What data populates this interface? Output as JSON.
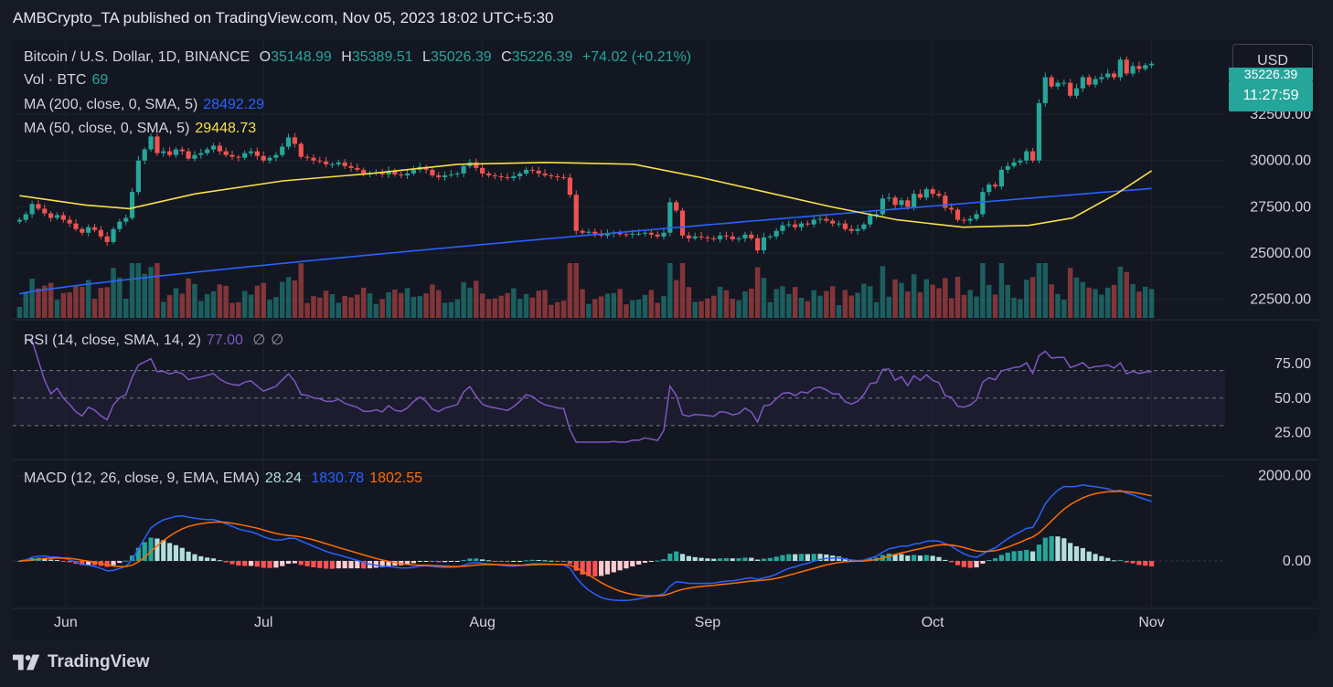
{
  "header": {
    "publisher_line": "AMBCrypto_TA published on TradingView.com, Nov 05, 2023 18:02 UTC+5:30"
  },
  "footer": {
    "brand": "TradingView"
  },
  "colors": {
    "up": "#26a69a",
    "down": "#ef5350",
    "ma200": "#2962ff",
    "ma50": "#f7e04a",
    "rsi": "#7e57c2",
    "macd": "#2962ff",
    "signal": "#ff6d00",
    "grid": "#1e222d",
    "axis_text": "#d1d4dc"
  },
  "toolbar": {
    "currency_button": "USD"
  },
  "price_tag": {
    "value_partial": "35226.39",
    "countdown": "11:27:59"
  },
  "legend": {
    "symbol": "Bitcoin / U.S. Dollar, 1D, BINANCE",
    "o_label": "O",
    "o_value": "35148.99",
    "h_label": "H",
    "h_value": "35389.51",
    "l_label": "L",
    "l_value": "35026.39",
    "c_label": "C",
    "c_value": "35226.39",
    "change": "+74.02 (+0.21%)",
    "vol_label": "Vol · BTC",
    "vol_value": "69",
    "ma200_label": "MA (200, close, 0, SMA, 5)",
    "ma200_value": "28492.29",
    "ma50_label": "MA (50, close, 0, SMA, 5)",
    "ma50_value": "29448.73",
    "rsi_label": "RSI (14, close, SMA, 14, 2)",
    "rsi_value": "77.00",
    "rsi_extra1": "∅",
    "rsi_extra2": "∅",
    "macd_label": "MACD (12, 26, close, 9, EMA, EMA)",
    "macd_hist": "28.24",
    "macd_value": "1830.78",
    "macd_signal": "1802.55"
  },
  "chart_data": [
    {
      "type": "candlestick",
      "title": "Bitcoin / U.S. Dollar, 1D, BINANCE",
      "x_ticks": [
        "Jun",
        "Jul",
        "Aug",
        "Sep",
        "Oct",
        "Nov"
      ],
      "y_ticks": [
        "22500.00",
        "25000.00",
        "27500.00",
        "30000.00",
        "32500.00"
      ],
      "ylim": [
        21500,
        36500
      ],
      "close_series": [
        26800,
        27100,
        27650,
        27400,
        27150,
        26900,
        27050,
        26800,
        26600,
        26300,
        26100,
        26400,
        26250,
        25900,
        25600,
        26300,
        26700,
        26900,
        28300,
        30000,
        30600,
        31300,
        30400,
        30500,
        30300,
        30600,
        30500,
        30100,
        30300,
        30400,
        30600,
        30800,
        30500,
        30300,
        30200,
        30150,
        30400,
        30500,
        30250,
        30000,
        30150,
        30300,
        30750,
        31250,
        30900,
        30200,
        30150,
        30000,
        29950,
        29800,
        29800,
        29900,
        29700,
        29600,
        29500,
        29300,
        29300,
        29350,
        29250,
        29450,
        29250,
        29200,
        29300,
        29500,
        29650,
        29500,
        29200,
        29100,
        29200,
        29250,
        29300,
        29700,
        29900,
        29600,
        29300,
        29200,
        29150,
        29100,
        29050,
        29150,
        29300,
        29500,
        29450,
        29300,
        29200,
        29150,
        29100,
        29080,
        28150,
        26200,
        26100,
        26150,
        26050,
        25950,
        26050,
        26100,
        26020,
        26000,
        26050,
        26050,
        26100,
        26000,
        25900,
        26100,
        27750,
        27300,
        25950,
        25800,
        25900,
        25850,
        25800,
        25750,
        25950,
        25900,
        25750,
        25800,
        26000,
        25800,
        25150,
        25850,
        25900,
        26200,
        26500,
        26550,
        26400,
        26600,
        26550,
        26800,
        26850,
        26750,
        26600,
        26600,
        26300,
        26200,
        26300,
        26550,
        27050,
        27100,
        27950,
        28000,
        27600,
        27850,
        27500,
        28200,
        28000,
        28450,
        28200,
        28100,
        27450,
        27350,
        26800,
        26750,
        26850,
        27100,
        28300,
        28700,
        28600,
        29500,
        29700,
        29900,
        30000,
        30500,
        30000,
        33100,
        34500,
        34000,
        34200,
        34200,
        33500,
        33900,
        34500,
        34100,
        34400,
        34500,
        34700,
        34500,
        35450,
        34700,
        35100,
        34950,
        35150,
        35230
      ],
      "ma200_start": 22800,
      "ma200_end": 28492.29,
      "ma50_points": [
        [
          0,
          28100
        ],
        [
          15,
          27600
        ],
        [
          25,
          27400
        ],
        [
          40,
          28200
        ],
        [
          60,
          28900
        ],
        [
          80,
          29300
        ],
        [
          100,
          29800
        ],
        [
          120,
          29900
        ],
        [
          140,
          29800
        ],
        [
          155,
          29100
        ],
        [
          170,
          28300
        ],
        [
          185,
          27500
        ],
        [
          200,
          26800
        ],
        [
          215,
          26400
        ],
        [
          230,
          26500
        ],
        [
          240,
          26900
        ],
        [
          250,
          28200
        ],
        [
          258,
          29448.73
        ]
      ]
    },
    {
      "type": "line",
      "title": "RSI (14, close, SMA, 14, 2)",
      "y_ticks": [
        "25.00",
        "50.00",
        "75.00"
      ],
      "bands": [
        30,
        50,
        70
      ],
      "last_value": 77.0
    },
    {
      "type": "bar",
      "title": "MACD (12, 26, close, 9, EMA, EMA)",
      "y_ticks": [
        "0.00",
        "2000.00"
      ],
      "last_hist": 28.24,
      "last_macd": 1830.78,
      "last_signal": 1802.55
    }
  ]
}
